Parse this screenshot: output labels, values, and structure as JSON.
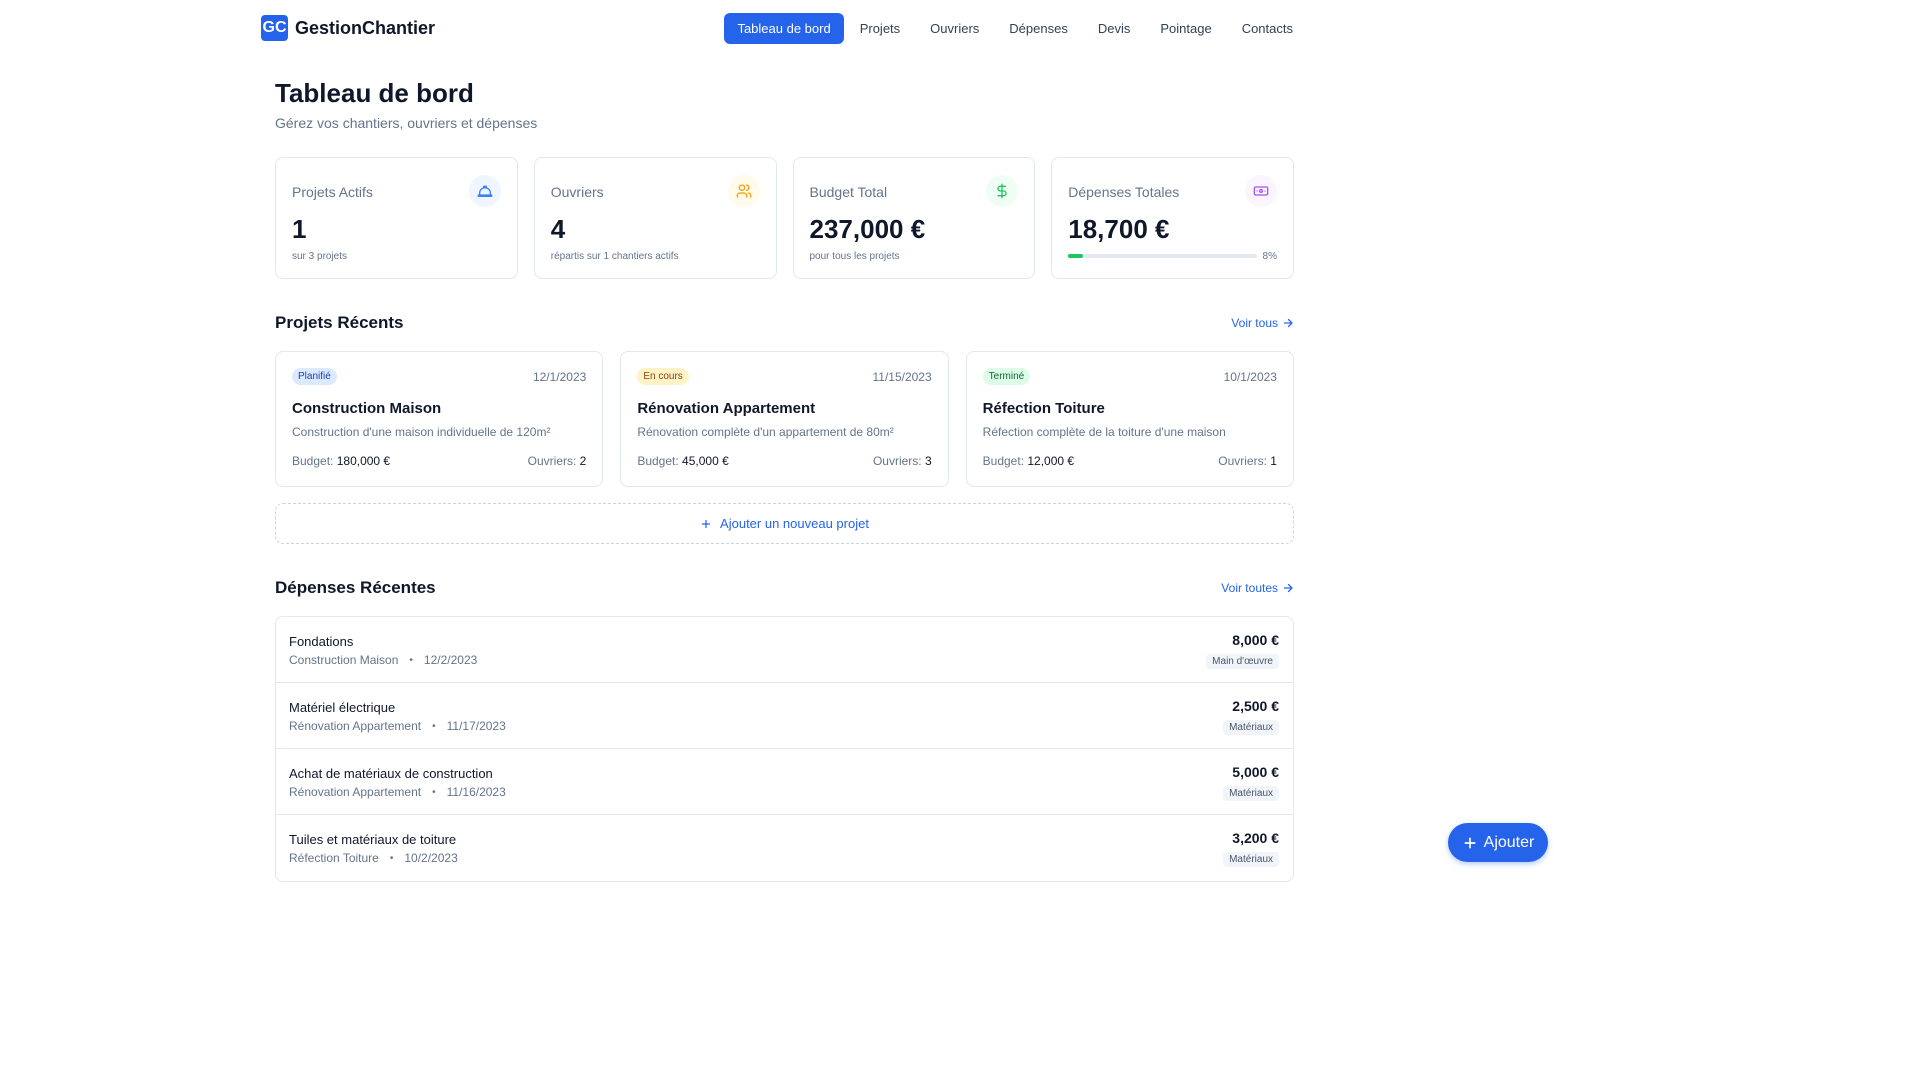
{
  "brand": {
    "logo": "GC",
    "name": "GestionChantier"
  },
  "nav": {
    "items": [
      {
        "label": "Tableau de bord"
      },
      {
        "label": "Projets"
      },
      {
        "label": "Ouvriers"
      },
      {
        "label": "Dépenses"
      },
      {
        "label": "Devis"
      },
      {
        "label": "Pointage"
      },
      {
        "label": "Contacts"
      }
    ],
    "active": "Tableau de bord"
  },
  "header": {
    "title": "Tableau de bord",
    "subtitle": "Gérez vos chantiers, ouvriers et dépenses"
  },
  "stats": {
    "projects": {
      "label": "Projets Actifs",
      "value": "1",
      "note": "sur 3 projets",
      "icon": "hard-hat-icon",
      "icon_color": "#3b82f6",
      "icon_bg": "#eff6ff"
    },
    "workers": {
      "label": "Ouvriers",
      "value": "4",
      "note": "répartis sur 1 chantiers actifs",
      "icon": "users-icon",
      "icon_color": "#f59e0b",
      "icon_bg": "#fffbeb"
    },
    "budget": {
      "label": "Budget Total",
      "value": "237,000 €",
      "note": "pour tous les projets",
      "icon": "dollar-icon",
      "icon_color": "#22c55e",
      "icon_bg": "#f0fdf4"
    },
    "expenses": {
      "label": "Dépenses Totales",
      "value": "18,700 €",
      "progress_percent": 8,
      "progress_text": "8%",
      "icon": "wallet-icon",
      "icon_color": "#a855f7",
      "icon_bg": "#faf5ff"
    }
  },
  "recent_projects": {
    "title": "Projets Récents",
    "link": "Voir tous",
    "budget_label": "Budget:",
    "workers_label": "Ouvriers:",
    "items": [
      {
        "status": "Planifié",
        "date": "12/1/2023",
        "name": "Construction Maison",
        "description": "Construction d'une maison individuelle de 120m²",
        "budget": "180,000 €",
        "workers": "2"
      },
      {
        "status": "En cours",
        "date": "11/15/2023",
        "name": "Rénovation Appartement",
        "description": "Rénovation complète d'un appartement de 80m²",
        "budget": "45,000 €",
        "workers": "3"
      },
      {
        "status": "Terminé",
        "date": "10/1/2023",
        "name": "Réfection Toiture",
        "description": "Réfection complète de la toiture d'une maison",
        "budget": "12,000 €",
        "workers": "1"
      }
    ],
    "add_label": "Ajouter un nouveau projet"
  },
  "recent_expenses": {
    "title": "Dépenses Récentes",
    "link": "Voir toutes",
    "items": [
      {
        "name": "Fondations",
        "project": "Construction Maison",
        "date": "12/2/2023",
        "amount": "8,000 €",
        "category": "Main d'œuvre"
      },
      {
        "name": "Matériel électrique",
        "project": "Rénovation Appartement",
        "date": "11/17/2023",
        "amount": "2,500 €",
        "category": "Matériaux"
      },
      {
        "name": "Achat de matériaux de construction",
        "project": "Rénovation Appartement",
        "date": "11/16/2023",
        "amount": "5,000 €",
        "category": "Matériaux"
      },
      {
        "name": "Tuiles et matériaux de toiture",
        "project": "Réfection Toiture",
        "date": "10/2/2023",
        "amount": "3,200 €",
        "category": "Matériaux"
      }
    ]
  },
  "fab": {
    "label": "Ajouter"
  },
  "colors": {
    "accent": "#2563eb",
    "text": "#0f172a",
    "muted": "#64748b",
    "border": "#e2e8f0"
  }
}
